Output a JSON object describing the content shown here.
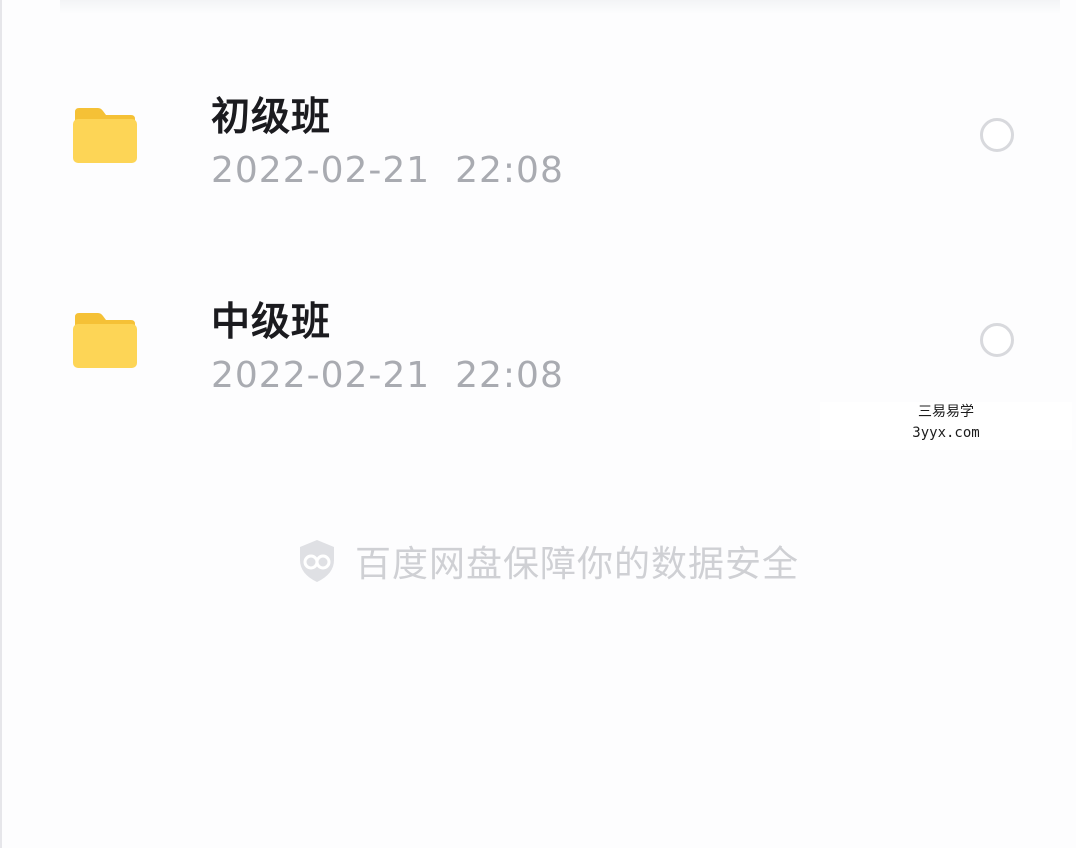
{
  "files": [
    {
      "name": "初级班",
      "date": "2022-02-21",
      "time": "22:08",
      "icon": "folder-icon"
    },
    {
      "name": "中级班",
      "date": "2022-02-21",
      "time": "22:08",
      "icon": "folder-icon"
    }
  ],
  "watermark": {
    "line1": "三易易学",
    "line2": "3yyx.com"
  },
  "footer": {
    "security_text": "百度网盘保障你的数据安全",
    "icon": "shield-icon"
  },
  "colors": {
    "folder": "#fcd34d",
    "folder_tab": "#f6c23a",
    "name_text": "#1b1b1f",
    "meta_text": "#a9abb1",
    "radio_border": "#d8d9dd",
    "security_text": "#cfd0d4"
  }
}
